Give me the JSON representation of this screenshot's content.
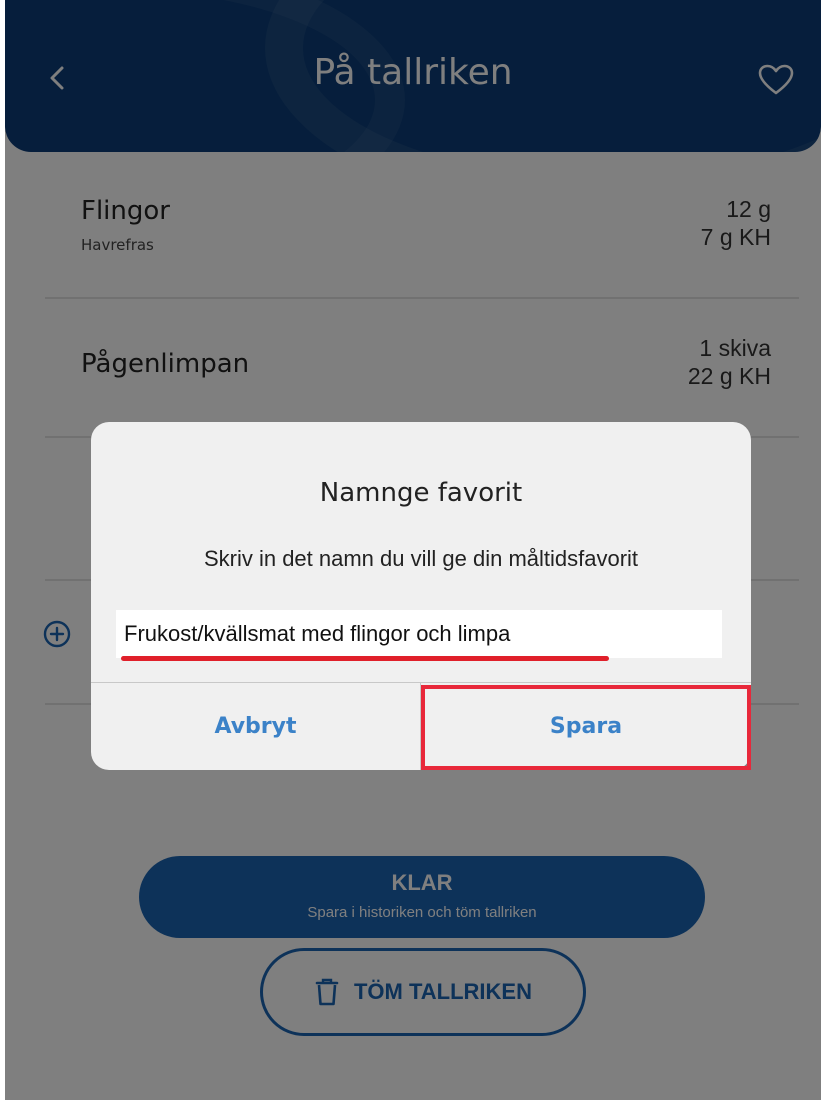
{
  "header": {
    "title": "På tallriken"
  },
  "items": [
    {
      "name": "Flingor",
      "sub": "Havrefras",
      "amount": "12 g",
      "kh": "7 g KH"
    },
    {
      "name": "Pågenlimpan",
      "sub": "",
      "amount": "1 skiva",
      "kh": "22 g KH"
    }
  ],
  "actions": {
    "klar_label": "KLAR",
    "klar_sub": "Spara i historiken och töm tallriken",
    "tom_label": "TÖM TALLRIKEN"
  },
  "dialog": {
    "title": "Namnge favorit",
    "message": "Skriv in det namn du vill ge din måltidsfavorit",
    "input_value": "Frukost/kvällsmat med flingor och limpa",
    "cancel_label": "Avbryt",
    "save_label": "Spara"
  },
  "colors": {
    "header_bg": "#0c3d78",
    "accent": "#1b64b3",
    "dialog_button": "#3b82c8",
    "highlight": "#e8283a"
  }
}
